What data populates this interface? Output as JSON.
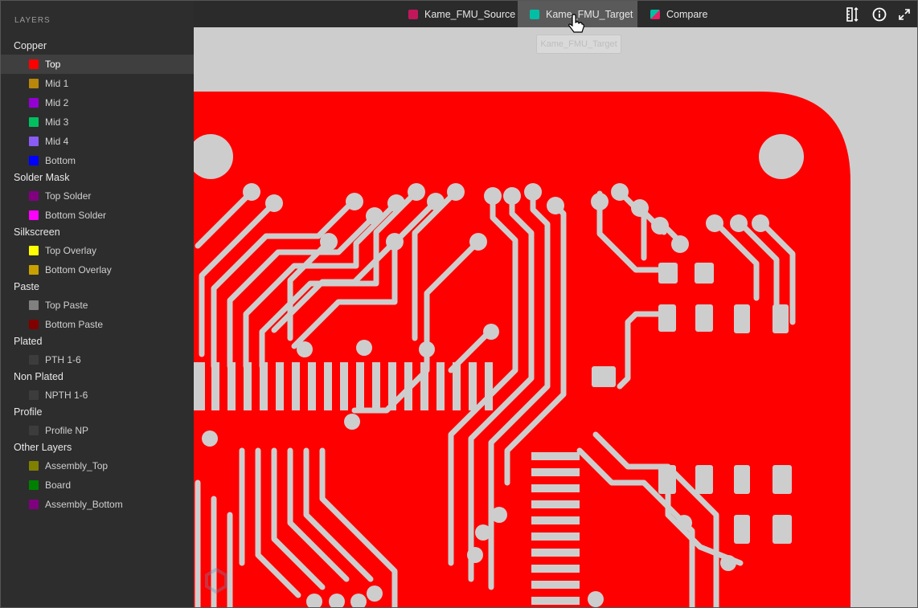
{
  "sidebar": {
    "title": "LAYERS",
    "groups": [
      {
        "label": "Copper",
        "items": [
          {
            "label": "Top",
            "color": "#ff0000",
            "active": true
          },
          {
            "label": "Mid 1",
            "color": "#b8860b"
          },
          {
            "label": "Mid 2",
            "color": "#9400d3"
          },
          {
            "label": "Mid 3",
            "color": "#00c060"
          },
          {
            "label": "Mid 4",
            "color": "#8a5cf5"
          },
          {
            "label": "Bottom",
            "color": "#0000ff"
          }
        ]
      },
      {
        "label": "Solder Mask",
        "items": [
          {
            "label": "Top Solder",
            "color": "#800080"
          },
          {
            "label": "Bottom Solder",
            "color": "#ff00ff"
          }
        ]
      },
      {
        "label": "Silkscreen",
        "items": [
          {
            "label": "Top Overlay",
            "color": "#ffff00"
          },
          {
            "label": "Bottom Overlay",
            "color": "#c8a000"
          }
        ]
      },
      {
        "label": "Paste",
        "items": [
          {
            "label": "Top Paste",
            "color": "#808080"
          },
          {
            "label": "Bottom Paste",
            "color": "#800000"
          }
        ]
      },
      {
        "label": "Plated",
        "items": [
          {
            "label": "PTH 1-6",
            "color": "#3c3c3c"
          }
        ]
      },
      {
        "label": "Non Plated",
        "items": [
          {
            "label": "NPTH 1-6",
            "color": "#3c3c3c"
          }
        ]
      },
      {
        "label": "Profile",
        "items": [
          {
            "label": "Profile NP",
            "color": "#3c3c3c"
          }
        ]
      },
      {
        "label": "Other Layers",
        "items": [
          {
            "label": "Assembly_Top",
            "color": "#808000"
          },
          {
            "label": "Board",
            "color": "#008000"
          },
          {
            "label": "Assembly_Bottom",
            "color": "#800080"
          }
        ]
      }
    ]
  },
  "tabs": [
    {
      "label": "Kame_FMU_Source",
      "color": "#c2185b",
      "active": false
    },
    {
      "label": "Kame_FMU_Target",
      "color": "#00bfa5",
      "active": true
    },
    {
      "label": "Compare",
      "color": "#e91e63",
      "active": false
    }
  ],
  "tooltip": "Kame_FMU_Target",
  "toolbar": {
    "ruler_icon": "ruler-icon",
    "info_icon": "info-icon",
    "fullscreen_icon": "fullscreen-icon"
  },
  "board": {
    "copper_color": "#ff0000",
    "background_color": "#cdcdcd"
  }
}
